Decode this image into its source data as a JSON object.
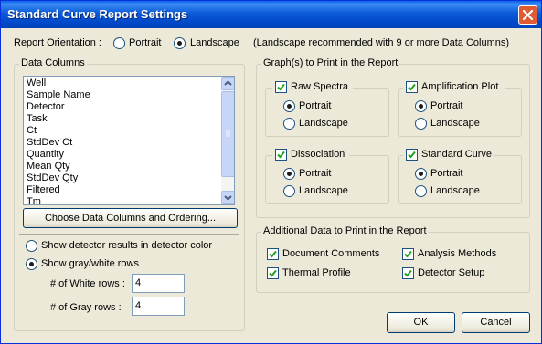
{
  "window": {
    "title": "Standard Curve Report Settings"
  },
  "orientation": {
    "label": "Report Orientation :",
    "options": [
      "Portrait",
      "Landscape"
    ],
    "selected": "Landscape",
    "note": "(Landscape recommended with 9 or more Data Columns)"
  },
  "data_columns": {
    "title": "Data Columns",
    "items": [
      "Well",
      "Sample Name",
      "Detector",
      "Task",
      "Ct",
      "StdDev Ct",
      "Quantity",
      "Mean Qty",
      "StdDev Qty",
      "Filtered",
      "Tm"
    ],
    "choose_button": "Choose Data Columns and Ordering...",
    "color_options": [
      "Show detector results in detector color",
      "Show gray/white rows"
    ],
    "color_selected": "Show gray/white rows",
    "white_rows_label": "# of White rows :",
    "white_rows_value": "4",
    "gray_rows_label": "# of Gray rows :",
    "gray_rows_value": "4"
  },
  "graphs": {
    "title": "Graph(s) to Print in the Report",
    "panels": [
      {
        "label": "Raw Spectra",
        "checked": true,
        "options": [
          "Portrait",
          "Landscape"
        ],
        "selected": "Portrait"
      },
      {
        "label": "Amplification Plot",
        "checked": true,
        "options": [
          "Portrait",
          "Landscape"
        ],
        "selected": "Portrait"
      },
      {
        "label": "Dissociation",
        "checked": true,
        "options": [
          "Portrait",
          "Landscape"
        ],
        "selected": "Portrait"
      },
      {
        "label": "Standard Curve",
        "checked": true,
        "options": [
          "Portrait",
          "Landscape"
        ],
        "selected": "Portrait"
      }
    ]
  },
  "additional": {
    "title": "Additional Data to Print in the Report",
    "items": [
      {
        "label": "Document Comments",
        "checked": true
      },
      {
        "label": "Analysis Methods",
        "checked": true
      },
      {
        "label": "Thermal Profile",
        "checked": true
      },
      {
        "label": "Detector Setup",
        "checked": true
      }
    ]
  },
  "buttons": {
    "ok": "OK",
    "cancel": "Cancel"
  },
  "colors": {
    "titlebar": "#0054e3",
    "dialog_bg": "#ece9d8",
    "close_button": "#e05a32"
  },
  "icons": [
    "close-icon",
    "check-mark-icon",
    "scroll-up-arrow-icon",
    "scroll-down-arrow-icon"
  ]
}
